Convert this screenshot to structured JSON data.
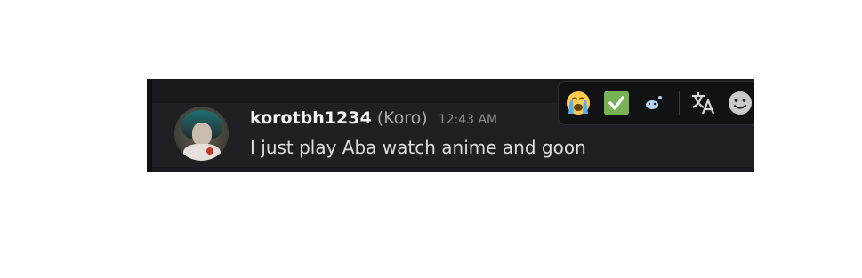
{
  "message": {
    "author": "korotbh1234",
    "nickname": "(Koro)",
    "timestamp": "12:43 AM",
    "content": "I just play Aba watch anime and goon",
    "avatar": "user-avatar"
  },
  "toolbar": {
    "actions": [
      {
        "name": "react-loudly-crying-face",
        "icon": "loudly-crying-face-emoji"
      },
      {
        "name": "react-check-mark",
        "icon": "white-check-mark-emoji"
      },
      {
        "name": "react-blue-heart",
        "icon": "small-blue-emoji"
      },
      {
        "name": "translate",
        "icon": "translate-icon"
      },
      {
        "name": "add-reaction",
        "icon": "smiley-face-icon"
      }
    ]
  },
  "colors": {
    "panel_background": "#1a1a1e",
    "message_hover_background": "#202024",
    "toolbar_background": "#111214",
    "author_color": "#f2f3f5",
    "nickname_color": "#a6a8ad",
    "timestamp_color": "#8a8d93",
    "text_color": "#dbdee1",
    "check_green": "#77b255"
  }
}
